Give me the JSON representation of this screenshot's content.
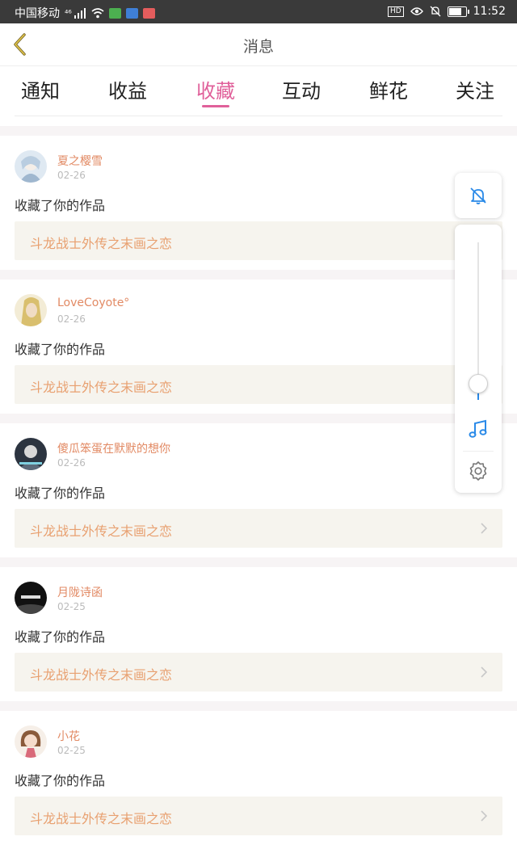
{
  "status_bar": {
    "carrier": "中国移动",
    "signal_label": "⁴⁶",
    "time": "11:52"
  },
  "header": {
    "title": "消息"
  },
  "tabs": [
    {
      "label": "通知",
      "active": false
    },
    {
      "label": "收益",
      "active": false
    },
    {
      "label": "收藏",
      "active": true
    },
    {
      "label": "互动",
      "active": false
    },
    {
      "label": "鲜花",
      "active": false
    },
    {
      "label": "关注",
      "active": false
    }
  ],
  "messages": [
    {
      "username": "夏之樱雪",
      "date": "02-26",
      "action": "收藏了你的作品",
      "work_title": "斗龙战士外传之末画之恋"
    },
    {
      "username": "LoveCoyote°",
      "date": "02-26",
      "action": "收藏了你的作品",
      "work_title": "斗龙战士外传之末画之恋"
    },
    {
      "username": "傻瓜笨蛋在默默的想你",
      "date": "02-26",
      "action": "收藏了你的作品",
      "work_title": "斗龙战士外传之末画之恋"
    },
    {
      "username": "月陇诗函",
      "date": "02-25",
      "action": "收藏了你的作品",
      "work_title": "斗龙战士外传之末画之恋"
    },
    {
      "username": "小花",
      "date": "02-25",
      "action": "收藏了你的作品",
      "work_title": "斗龙战士外传之末画之恋"
    }
  ],
  "floating_controls": {
    "volume_level": 0.05,
    "icons": [
      "bell-off-icon",
      "music-note-icon",
      "gear-icon"
    ]
  },
  "colors": {
    "accent": "#e0609a",
    "username": "#e28a64",
    "work_title": "#e8a070",
    "control_blue": "#2a8ae8"
  }
}
